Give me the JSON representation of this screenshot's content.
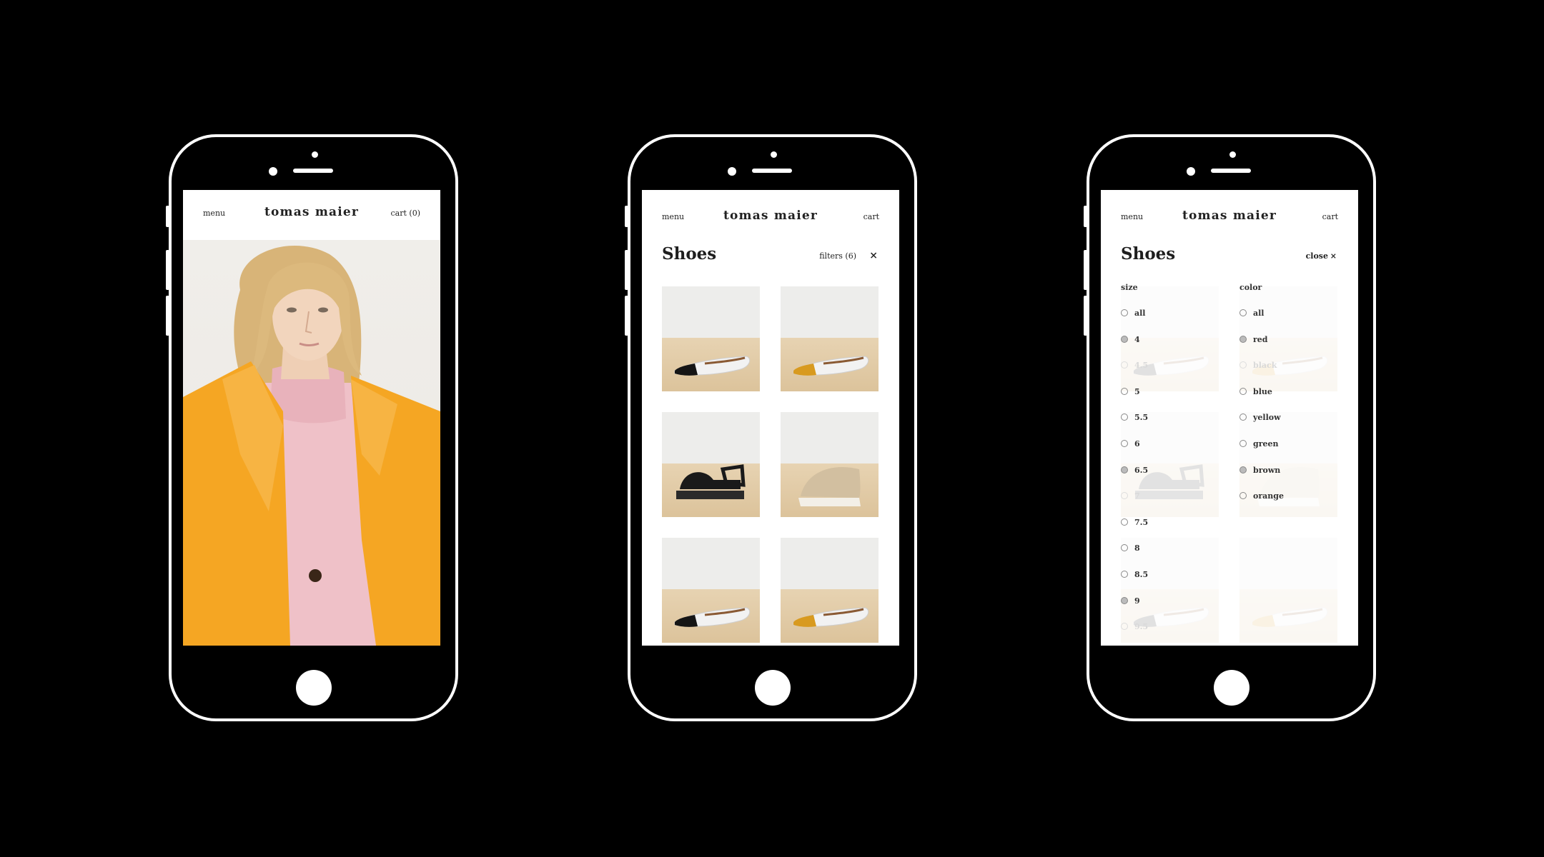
{
  "brand": "tomas maier",
  "phone1": {
    "menu": "menu",
    "cart": "cart (0)"
  },
  "phone2": {
    "menu": "menu",
    "cart": "cart",
    "title": "Shoes",
    "filters": "filters  (6)",
    "close_icon": "×"
  },
  "phone3": {
    "menu": "menu",
    "cart": "cart",
    "title": "Shoes",
    "close": "close",
    "close_icon": "×",
    "size_label": "size",
    "color_label": "color",
    "sizes": [
      {
        "label": "all",
        "state": "normal"
      },
      {
        "label": "4",
        "state": "selected"
      },
      {
        "label": "4.5",
        "state": "disabled"
      },
      {
        "label": "5",
        "state": "normal"
      },
      {
        "label": "5.5",
        "state": "normal"
      },
      {
        "label": "6",
        "state": "normal"
      },
      {
        "label": "6.5",
        "state": "selected"
      },
      {
        "label": "7",
        "state": "disabled"
      },
      {
        "label": "7.5",
        "state": "normal"
      },
      {
        "label": "8",
        "state": "normal"
      },
      {
        "label": "8.5",
        "state": "normal"
      },
      {
        "label": "9",
        "state": "selected"
      },
      {
        "label": "9.5",
        "state": "disabled"
      }
    ],
    "colors": [
      {
        "label": "all",
        "state": "normal"
      },
      {
        "label": "red",
        "state": "selected"
      },
      {
        "label": "black",
        "state": "disabled"
      },
      {
        "label": "blue",
        "state": "normal"
      },
      {
        "label": "yellow",
        "state": "normal"
      },
      {
        "label": "green",
        "state": "normal"
      },
      {
        "label": "brown",
        "state": "selected"
      },
      {
        "label": "orange",
        "state": "normal"
      }
    ]
  },
  "products": [
    {
      "name": "pointed flat black toe",
      "toe": "#151515"
    },
    {
      "name": "pointed flat yellow toe",
      "toe": "#d89a1f"
    },
    {
      "name": "black strap sandal",
      "toe": "#151515"
    },
    {
      "name": "fur platform slide",
      "toe": "#cdb99b"
    },
    {
      "name": "pointed flat black toe",
      "toe": "#151515"
    },
    {
      "name": "pointed flat yellow toe",
      "toe": "#d89a1f"
    }
  ],
  "colors": {
    "background": "#000000",
    "phone_outline": "#ffffff",
    "coat": "#f5a623",
    "sweater": "#efc1c8"
  }
}
